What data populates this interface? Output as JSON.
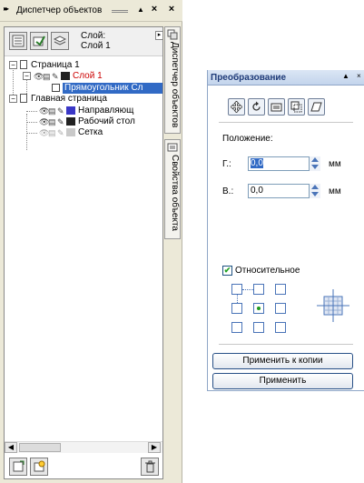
{
  "object_manager": {
    "title": "Диспетчер объектов",
    "close_glyph": "×",
    "menu_glyph": "▲",
    "layer_label": "Слой:",
    "layer_value": "Слой 1",
    "tabs": [
      "Диспетчер объектов",
      "Свойства объекта"
    ],
    "tree": [
      {
        "label": "Страница 1"
      },
      {
        "label": "Слой 1",
        "color": "#cc0000"
      },
      {
        "label": "Прямоугольник  Сл",
        "selected": true
      },
      {
        "label": "Главная страница"
      },
      {
        "label": "Направляющ",
        "swatch": "#3a37c6"
      },
      {
        "label": "Рабочий стол",
        "swatch": "#222222"
      },
      {
        "label": "Сетка",
        "swatch": "#c9c9c9",
        "dim": true
      }
    ]
  },
  "transform": {
    "title": "Преобразование",
    "position_label": "Положение:",
    "h_label": "Г.:",
    "h_value": "0,0",
    "v_label": "В.:",
    "v_value": "0,0",
    "unit": "мм",
    "relative_label": "Относительное",
    "relative_checked": true,
    "apply_copy_label": "Применить к копии",
    "apply_label": "Применить"
  },
  "colors": {
    "selection": "#316ac5",
    "accent_blue": "#4a74b8",
    "docker_bg": "#ece9d8"
  }
}
